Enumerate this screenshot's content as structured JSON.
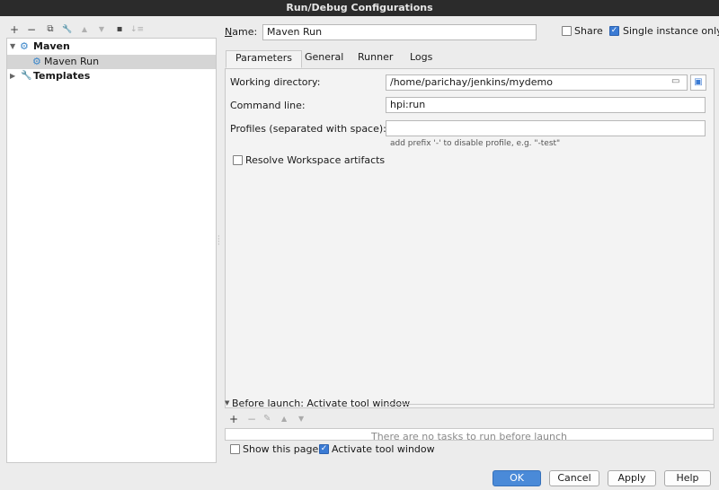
{
  "window": {
    "title": "Run/Debug Configurations"
  },
  "toolbar": {
    "add": "+",
    "remove": "−",
    "copy": "⧉",
    "edit": "🔧",
    "up": "▲",
    "down": "▼",
    "folder": "▪",
    "sort": "↓≡"
  },
  "tree": {
    "items": [
      {
        "label": "Maven",
        "expanded": true
      },
      {
        "label": "Maven Run",
        "selected": true
      },
      {
        "label": "Templates",
        "expanded": false
      }
    ]
  },
  "form": {
    "name_label": "Name:",
    "name_value": "Maven Run",
    "share_label": "Share",
    "share_checked": false,
    "single_instance_label": "Single instance only",
    "single_instance_checked": true
  },
  "tabs": [
    "Parameters",
    "General",
    "Runner",
    "Logs"
  ],
  "params": {
    "working_dir_label": "Working directory:",
    "working_dir_value": "/home/parichay/jenkins/mydemo",
    "command_line_label": "Command line:",
    "command_line_value": "hpi:run",
    "profiles_label": "Profiles (separated with space):",
    "profiles_value": "",
    "profiles_hint": "add prefix '-' to disable profile, e.g. \"-test\"",
    "resolve_label": "Resolve Workspace artifacts",
    "resolve_checked": false
  },
  "before_launch": {
    "title": "Before launch: Activate tool window",
    "empty_text": "There are no tasks to run before launch",
    "show_page_label": "Show this page",
    "show_page_checked": false,
    "activate_label": "Activate tool window",
    "activate_checked": true
  },
  "buttons": {
    "ok": "OK",
    "cancel": "Cancel",
    "apply": "Apply",
    "help": "Help"
  },
  "colors": {
    "primary": "#4a8ad8",
    "titlebar": "#2b2b2b",
    "selection": "#d5d5d5"
  }
}
